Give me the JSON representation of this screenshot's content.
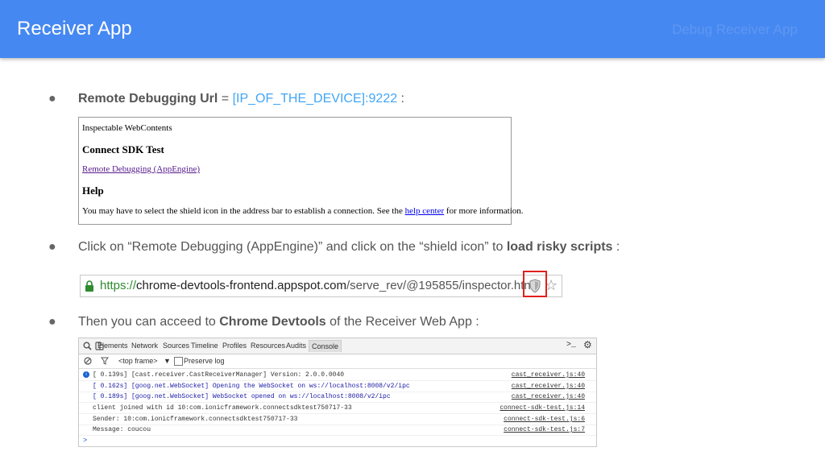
{
  "header": {
    "title": "Receiver App",
    "right_label": "Debug Receiver App"
  },
  "bullets": [
    {
      "marker": "●",
      "label_bold": "Remote Debugging Url",
      "separator": " = ",
      "url": "[IP_OF_THE_DEVICE]:9222",
      "suffix": " :"
    },
    {
      "marker": "●",
      "text": "Click on “Remote Debugging (AppEngine)” and click on the “shield icon” to ",
      "bold": "load risky scripts",
      "suffix": " :"
    },
    {
      "marker": "●",
      "text": "Then you can acceed to ",
      "bold": "Chrome Devtools",
      "suffix": " of the Receiver Web App :"
    }
  ],
  "inspectable": {
    "heading": "Inspectable WebContents",
    "app_name": "Connect SDK Test",
    "link": "Remote Debugging (AppEngine)",
    "help_title": "Help",
    "help_text_before": "You may have to select the shield icon in the address bar to establish a connection. See the ",
    "help_link": "help center",
    "help_text_after": " for more information."
  },
  "address_bar": {
    "scheme": "https://",
    "host": "chrome-devtools-frontend.appspot.com",
    "path": "/serve_rev/@195855/inspector.htn",
    "icons": [
      "lock-icon",
      "shield-icon",
      "star-icon"
    ]
  },
  "devtools": {
    "tabs": [
      "Elements",
      "Network",
      "Sources",
      "Timeline",
      "Profiles",
      "Resources",
      "Audits",
      "Console"
    ],
    "active_tab": "Console",
    "frame_select": "<top frame>",
    "preserve_log": "Preserve log",
    "rows": [
      {
        "msg": "[  0.139s] [cast.receiver.CastReceiverManager] Version: 2.0.0.0040",
        "src": "cast_receiver.js:40",
        "style": "info"
      },
      {
        "msg": "[  0.162s] [goog.net.WebSocket] Opening the WebSocket on ws://localhost:8008/v2/ipc",
        "src": "cast_receiver.js:40",
        "style": "blue"
      },
      {
        "msg": "[  0.189s] [goog.net.WebSocket] WebSocket opened on ws://localhost:8008/v2/ipc",
        "src": "cast_receiver.js:40",
        "style": "blue"
      },
      {
        "msg": "client joined with id 10:com.ionicframework.connectsdktest750717-33",
        "src": "connect-sdk-test.js:14",
        "style": "plain"
      },
      {
        "msg": "Sender: 10:com.ionicframework.connectsdktest750717-33",
        "src": "connect-sdk-test.js:6",
        "style": "plain"
      },
      {
        "msg": "Message: coucou",
        "src": "connect-sdk-test.js:7",
        "style": "plain"
      }
    ],
    "prompt": ">"
  }
}
